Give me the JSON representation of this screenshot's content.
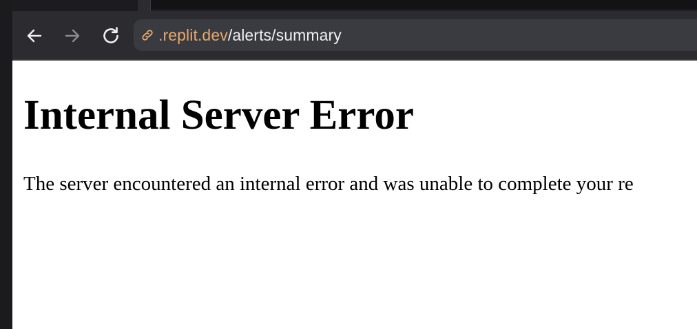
{
  "browser": {
    "url": {
      "domain": ".replit.dev",
      "path": "/alerts/summary"
    },
    "icons": {
      "back": "back-arrow-icon",
      "forward": "forward-arrow-icon",
      "reload": "reload-icon",
      "site_info": "link-icon"
    },
    "colors": {
      "toolbar": "#2b2b30",
      "urlbar": "#3a3b40",
      "domain": "#e8a86b"
    }
  },
  "page": {
    "title": "Internal Server Error",
    "message": "The server encountered an internal error and was unable to complete your re"
  }
}
